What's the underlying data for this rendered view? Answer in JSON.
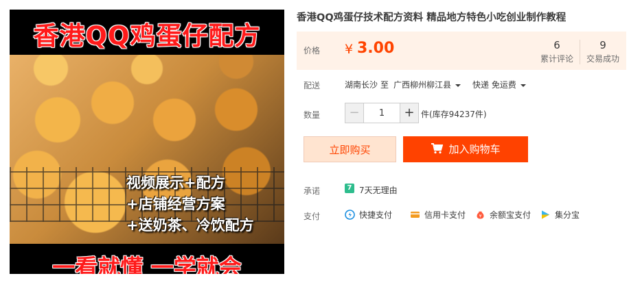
{
  "image": {
    "title": "香港QQ鸡蛋仔配方",
    "lines": [
      "视频展示+配方",
      "+店铺经营方案",
      "+送奶茶、冷饮配方"
    ],
    "bottom": "一看就懂 一学就会"
  },
  "product": {
    "title": "香港QQ鸡蛋仔技术配方资料 精品地方特色小吃创业制作教程"
  },
  "price": {
    "label": "价格",
    "currency": "¥",
    "value": "3.00",
    "reviews_count": "6",
    "reviews_label": "累计评论",
    "deals_count": "9",
    "deals_label": "交易成功"
  },
  "shipping": {
    "label": "配送",
    "from": "湖南长沙",
    "to_word": "至",
    "to": "广西柳州柳江县",
    "method": "快递 免运费"
  },
  "quantity": {
    "label": "数量",
    "minus": "−",
    "value": "1",
    "plus": "+",
    "stock": "件(库存94237件)"
  },
  "actions": {
    "buy": "立即购买",
    "cart": "加入购物车"
  },
  "promise": {
    "label": "承诺",
    "icon_text": "7",
    "text": "7天无理由"
  },
  "payment": {
    "label": "支付",
    "methods": [
      "快捷支付",
      "信用卡支付",
      "余额宝支付",
      "集分宝"
    ]
  },
  "colors": {
    "accent": "#ff4400",
    "cart_bg": "#ff4200",
    "price_bg": "#fff2e8",
    "promise_green": "#2ebd8d"
  }
}
